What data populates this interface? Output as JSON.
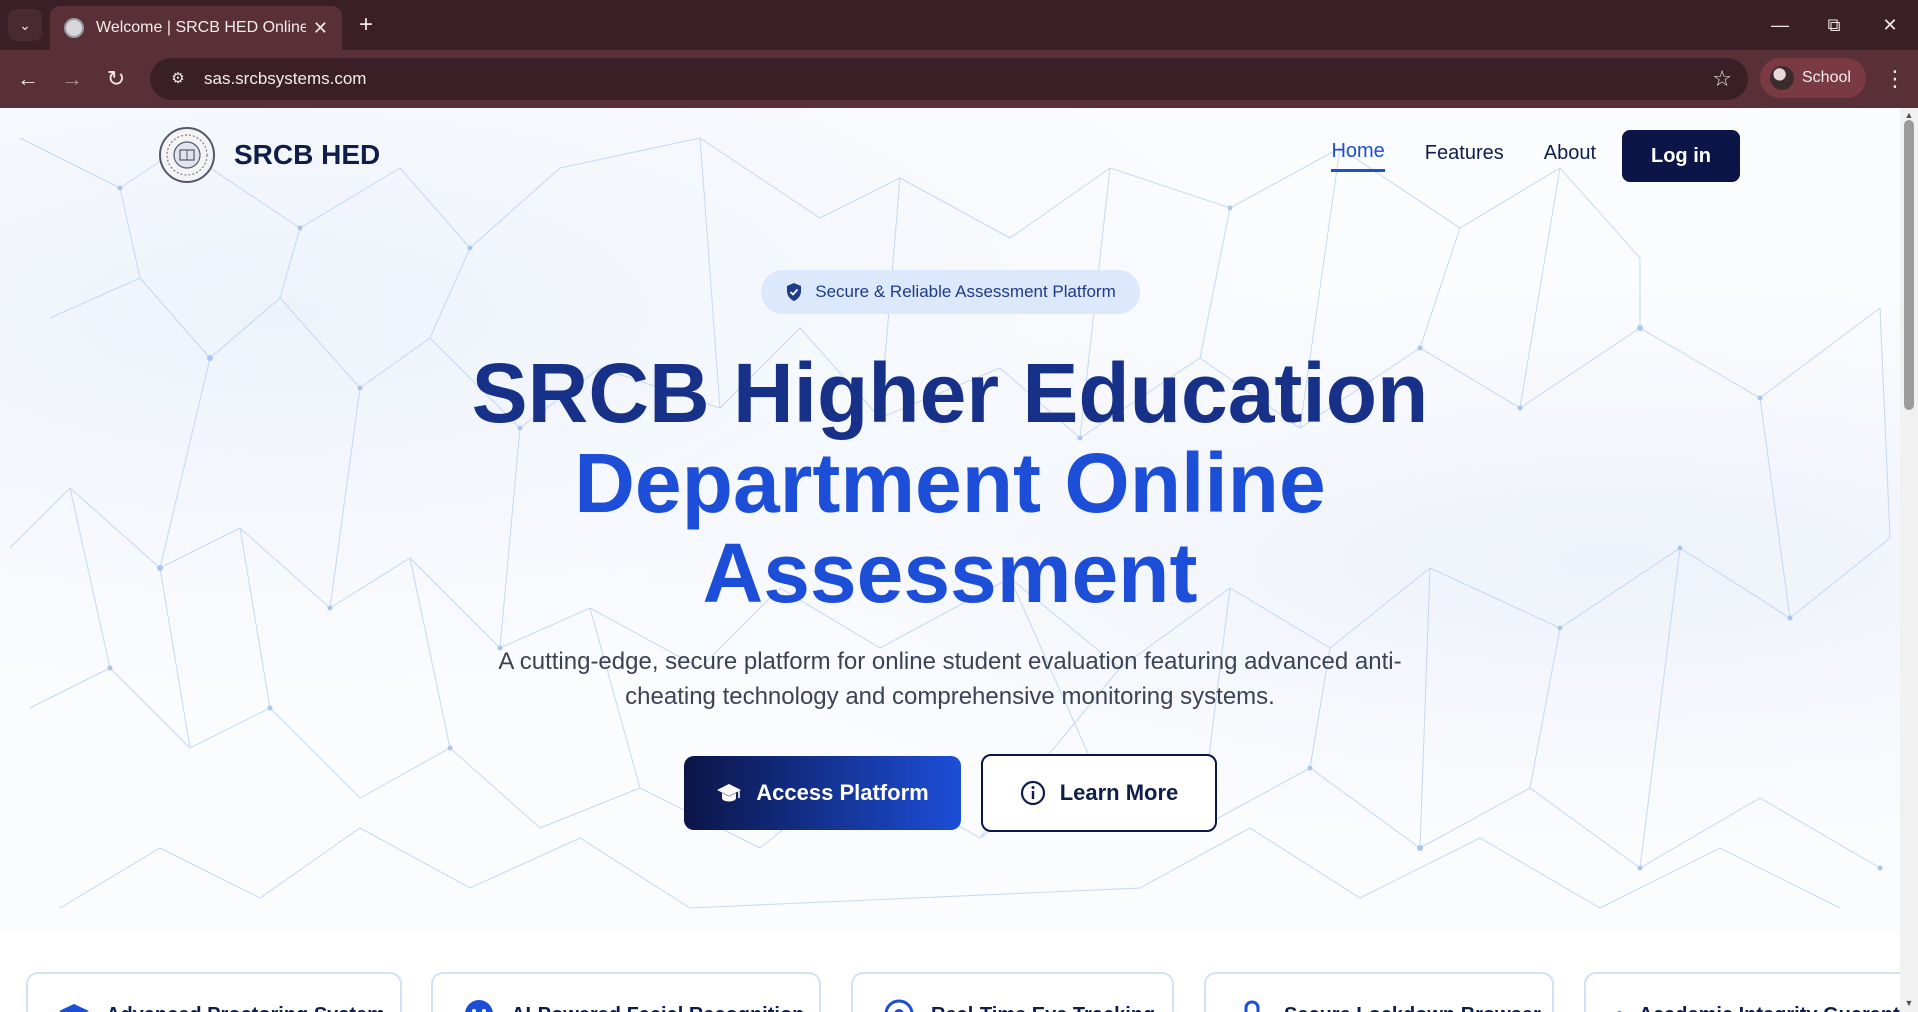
{
  "browser": {
    "tab_title": "Welcome | SRCB HED Online Assessment",
    "url": "sas.srcbsystems.com",
    "profile_name": "School"
  },
  "site": {
    "brand_name": "SRCB HED",
    "nav": {
      "home": "Home",
      "features": "Features",
      "about": "About",
      "login": "Log in"
    },
    "badge": "Secure & Reliable Assessment Platform",
    "headline": {
      "line1": "SRCB Higher Education",
      "line2": "Department Online",
      "line3": "Assessment"
    },
    "lead_line1": "A cutting-edge, secure platform for online student evaluation featuring advanced anti-",
    "lead_line2": "cheating technology and comprehensive monitoring systems.",
    "cta_primary": "Access Platform",
    "cta_secondary": "Learn More",
    "features": [
      {
        "title": "Advanced Proctoring System",
        "icon": "graduation-cap-icon"
      },
      {
        "title": "AI-Powered Facial Recognition",
        "icon": "face-scan-icon"
      },
      {
        "title": "Real-Time Eye Tracking",
        "icon": "eye-icon"
      },
      {
        "title": "Secure Lockdown Browser",
        "icon": "lock-icon"
      },
      {
        "title": "Academic Integrity Guarantee",
        "icon": "check-shield-icon"
      }
    ]
  },
  "colors": {
    "navy": "#0b1547",
    "accent_blue": "#1d4ed8",
    "headline_dark": "#173189",
    "badge_bg": "#dce8fb",
    "browser_chrome": "#5a3038"
  }
}
